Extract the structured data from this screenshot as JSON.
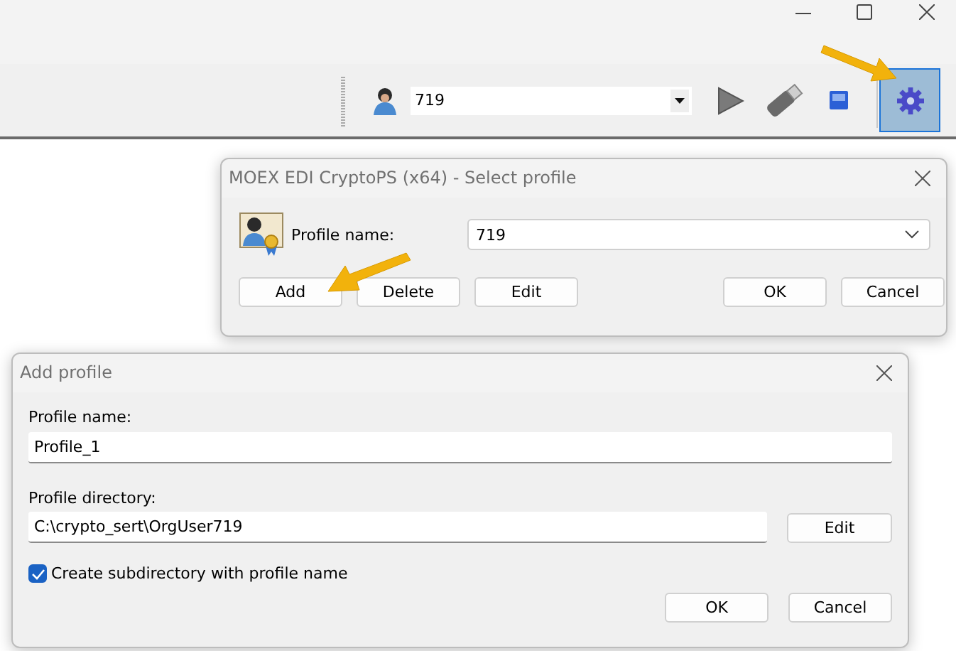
{
  "toolbar": {
    "profile_value": "719",
    "settings_active": true
  },
  "select_profile_dialog": {
    "title": "MOEX EDI CryptoPS (x64) - Select profile",
    "profile_label": "Profile name:",
    "profile_value": "719",
    "buttons": [
      "Add",
      "Delete",
      "Edit"
    ],
    "footer_buttons": [
      "OK",
      "Cancel"
    ]
  },
  "add_profile_dialog": {
    "title": "Add profile",
    "name_label": "Profile name:",
    "name_value": "Profile_1",
    "directory_label": "Profile directory:",
    "directory_value": "C:\\crypto_sert\\OrgUser719",
    "directory_button": "Edit",
    "checkbox": {
      "label": "Create subdirectory with profile name",
      "checked": true
    },
    "buttons": [
      "OK",
      "Cancel"
    ]
  }
}
